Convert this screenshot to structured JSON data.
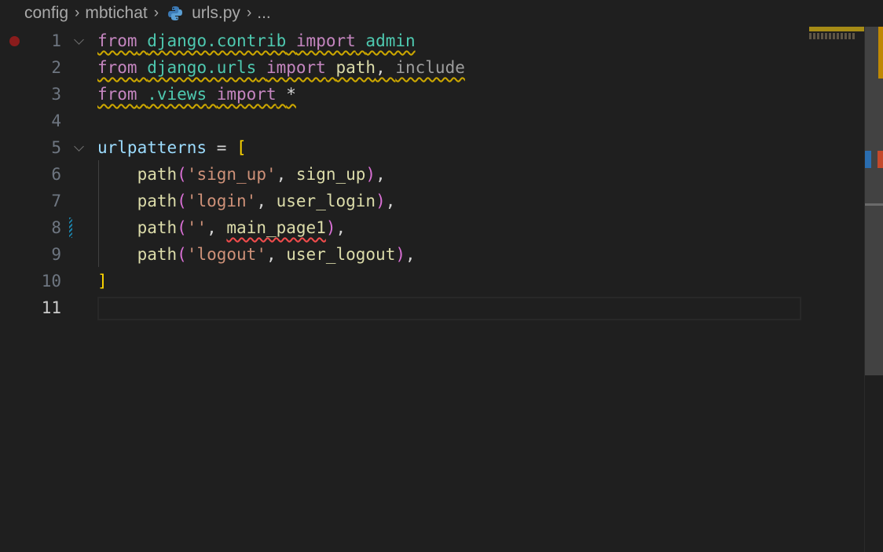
{
  "breadcrumb": {
    "items": [
      "config",
      "mbtichat"
    ],
    "file": "urls.py",
    "ellipsis": "..."
  },
  "editor": {
    "line_numbers": [
      "1",
      "2",
      "3",
      "4",
      "5",
      "6",
      "7",
      "8",
      "9",
      "10",
      "11"
    ],
    "active_line": "11",
    "lines": [
      [
        {
          "t": "from",
          "c": "kw",
          "sq": "y"
        },
        {
          "t": " ",
          "c": "plain",
          "sq": "y"
        },
        {
          "t": "django.contrib",
          "c": "mod-c",
          "sq": "y"
        },
        {
          "t": " ",
          "c": "plain",
          "sq": "y"
        },
        {
          "t": "import",
          "c": "kw",
          "sq": "y"
        },
        {
          "t": " ",
          "c": "plain",
          "sq": "y"
        },
        {
          "t": "admin",
          "c": "mod-c",
          "sq": "y"
        }
      ],
      [
        {
          "t": "from",
          "c": "kw",
          "sq": "y"
        },
        {
          "t": " ",
          "c": "plain",
          "sq": "y"
        },
        {
          "t": "django.urls",
          "c": "mod-c",
          "sq": "y"
        },
        {
          "t": " ",
          "c": "plain",
          "sq": "y"
        },
        {
          "t": "import",
          "c": "kw",
          "sq": "y"
        },
        {
          "t": " ",
          "c": "plain",
          "sq": "y"
        },
        {
          "t": "path",
          "c": "fn",
          "sq": "y"
        },
        {
          "t": ", ",
          "c": "plain",
          "sq": "y"
        },
        {
          "t": "include",
          "c": "dim",
          "sq": "y"
        }
      ],
      [
        {
          "t": "from",
          "c": "kw",
          "sq": "y"
        },
        {
          "t": " ",
          "c": "plain",
          "sq": "y"
        },
        {
          "t": ".views",
          "c": "mod-c",
          "sq": "y"
        },
        {
          "t": " ",
          "c": "plain",
          "sq": "y"
        },
        {
          "t": "import",
          "c": "kw",
          "sq": "y"
        },
        {
          "t": " ",
          "c": "plain",
          "sq": "y"
        },
        {
          "t": "*",
          "c": "plain",
          "sq": "y"
        }
      ],
      [],
      [
        {
          "t": "urlpatterns",
          "c": "var"
        },
        {
          "t": " = ",
          "c": "plain"
        },
        {
          "t": "[",
          "c": "br1"
        }
      ],
      [
        {
          "t": "    ",
          "c": "plain"
        },
        {
          "t": "path",
          "c": "fn"
        },
        {
          "t": "(",
          "c": "br2"
        },
        {
          "t": "'sign_up'",
          "c": "str"
        },
        {
          "t": ", ",
          "c": "plain"
        },
        {
          "t": "sign_up",
          "c": "fn"
        },
        {
          "t": ")",
          "c": "br2"
        },
        {
          "t": ",",
          "c": "plain"
        }
      ],
      [
        {
          "t": "    ",
          "c": "plain"
        },
        {
          "t": "path",
          "c": "fn"
        },
        {
          "t": "(",
          "c": "br2"
        },
        {
          "t": "'login'",
          "c": "str"
        },
        {
          "t": ", ",
          "c": "plain"
        },
        {
          "t": "user_login",
          "c": "fn"
        },
        {
          "t": ")",
          "c": "br2"
        },
        {
          "t": ",",
          "c": "plain"
        }
      ],
      [
        {
          "t": "    ",
          "c": "plain"
        },
        {
          "t": "path",
          "c": "fn"
        },
        {
          "t": "(",
          "c": "br2"
        },
        {
          "t": "''",
          "c": "str"
        },
        {
          "t": ", ",
          "c": "plain"
        },
        {
          "t": "main_page1",
          "c": "fn",
          "sq": "r"
        },
        {
          "t": ")",
          "c": "br2"
        },
        {
          "t": ",",
          "c": "plain"
        }
      ],
      [
        {
          "t": "    ",
          "c": "plain"
        },
        {
          "t": "path",
          "c": "fn"
        },
        {
          "t": "(",
          "c": "br2"
        },
        {
          "t": "'logout'",
          "c": "str"
        },
        {
          "t": ", ",
          "c": "plain"
        },
        {
          "t": "user_logout",
          "c": "fn"
        },
        {
          "t": ")",
          "c": "br2"
        },
        {
          "t": ",",
          "c": "plain"
        }
      ],
      [
        {
          "t": "]",
          "c": "br1"
        }
      ],
      []
    ]
  },
  "colors": {
    "keyword": "#c586c0",
    "module": "#4ec9b0",
    "function": "#dcdcaa",
    "string": "#ce9178",
    "variable": "#9cdcfe",
    "bracket_level1": "#ffd700",
    "bracket_level2": "#da70d6",
    "warning_squiggle": "#cca700",
    "error_squiggle": "#f14c4c",
    "breakpoint": "#8a1c1c",
    "modified_gutter": "#1b81a8"
  },
  "icons": {
    "breadcrumb_separator": "chevron-right-icon",
    "file_type": "python-icon",
    "fold": "chevron-down-icon",
    "breakpoint": "breakpoint-icon"
  }
}
